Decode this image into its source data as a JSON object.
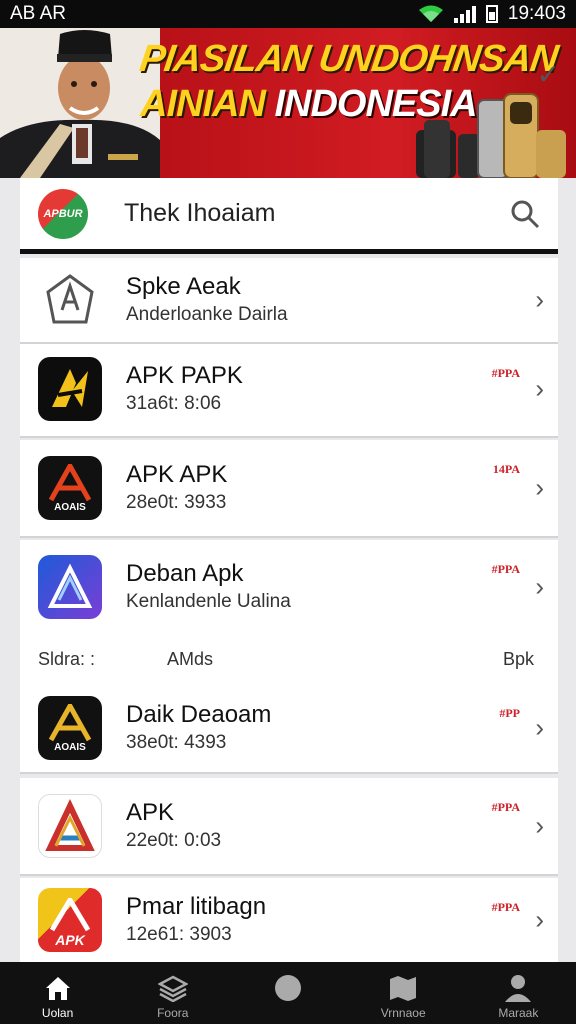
{
  "status_bar": {
    "left_text": "AB AR",
    "time": "19:403"
  },
  "banner": {
    "line1": "PIASILAN UNDOHNSAN",
    "line2_yellow": "AINIAN",
    "line2_white": "INDONESIA"
  },
  "search_bar": {
    "logo_text": "APBUR",
    "title": "Thek Ihoaiam"
  },
  "apps": [
    {
      "title": "Spke Aeak",
      "subtitle": "Anderloanke Dairla",
      "badge": ""
    },
    {
      "title": "APK PAPK",
      "subtitle": "31a6t: 8:06",
      "badge": "#PPA"
    },
    {
      "title": "APK APK",
      "subtitle": "28e0t: 3933",
      "badge": "14PA",
      "icon_text": "AOAIS"
    },
    {
      "title": "Deban Apk",
      "subtitle": "Kenlandenle Ualina",
      "badge": "#PPA"
    },
    {
      "title": "Daik Deaoam",
      "subtitle": "38e0t: 4393",
      "badge": "#PP",
      "icon_text": "AOAIS"
    },
    {
      "title": "APK",
      "subtitle": "22e0t: 0:03",
      "badge": "#PPA"
    },
    {
      "title": "Pmar litibagn",
      "subtitle": "12e61: 3903",
      "badge": "#PPA",
      "icon_text": "APK"
    }
  ],
  "meta_row": {
    "left": "Sldra: :",
    "middle": "AMds",
    "right": "Bpk"
  },
  "nav": [
    {
      "label": "Uolan",
      "icon": "home-icon",
      "active": true
    },
    {
      "label": "Foora",
      "icon": "layers-icon",
      "active": false
    },
    {
      "label": "",
      "icon": "circle-icon",
      "active": false
    },
    {
      "label": "Vrnnaoe",
      "icon": "map-icon",
      "active": false
    },
    {
      "label": "Maraak",
      "icon": "person-icon",
      "active": false
    }
  ],
  "colors": {
    "banner_red": "#c7141c",
    "banner_yellow": "#ffd21f",
    "badge_red": "#d0212a",
    "nav_bg": "#111111"
  }
}
